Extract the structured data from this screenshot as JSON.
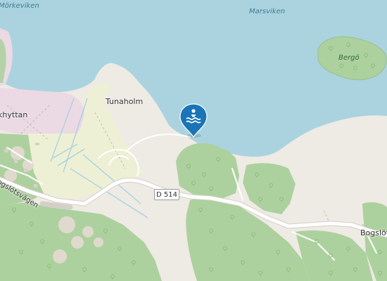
{
  "map": {
    "water_labels": [
      "Mörkeviken",
      "Marsviken"
    ],
    "island_labels": [
      "Bergö"
    ],
    "place_labels": [
      "Tunaholm",
      "Bogslöt",
      "Ökkhyttan"
    ],
    "street_labels": [
      "Bogslötsvägen"
    ],
    "road_shield": "D 514",
    "marker": {
      "icon": "swimming-icon",
      "category": "bathing-place",
      "color": "#1a74b8"
    },
    "colors": {
      "water": "#aad3df",
      "land": "#eeeae4",
      "forest": "#add19e",
      "farmland": "#eef0d5",
      "residential": "#ebd9e4",
      "road": "#ffffff",
      "marker": "#1a74b8"
    }
  }
}
